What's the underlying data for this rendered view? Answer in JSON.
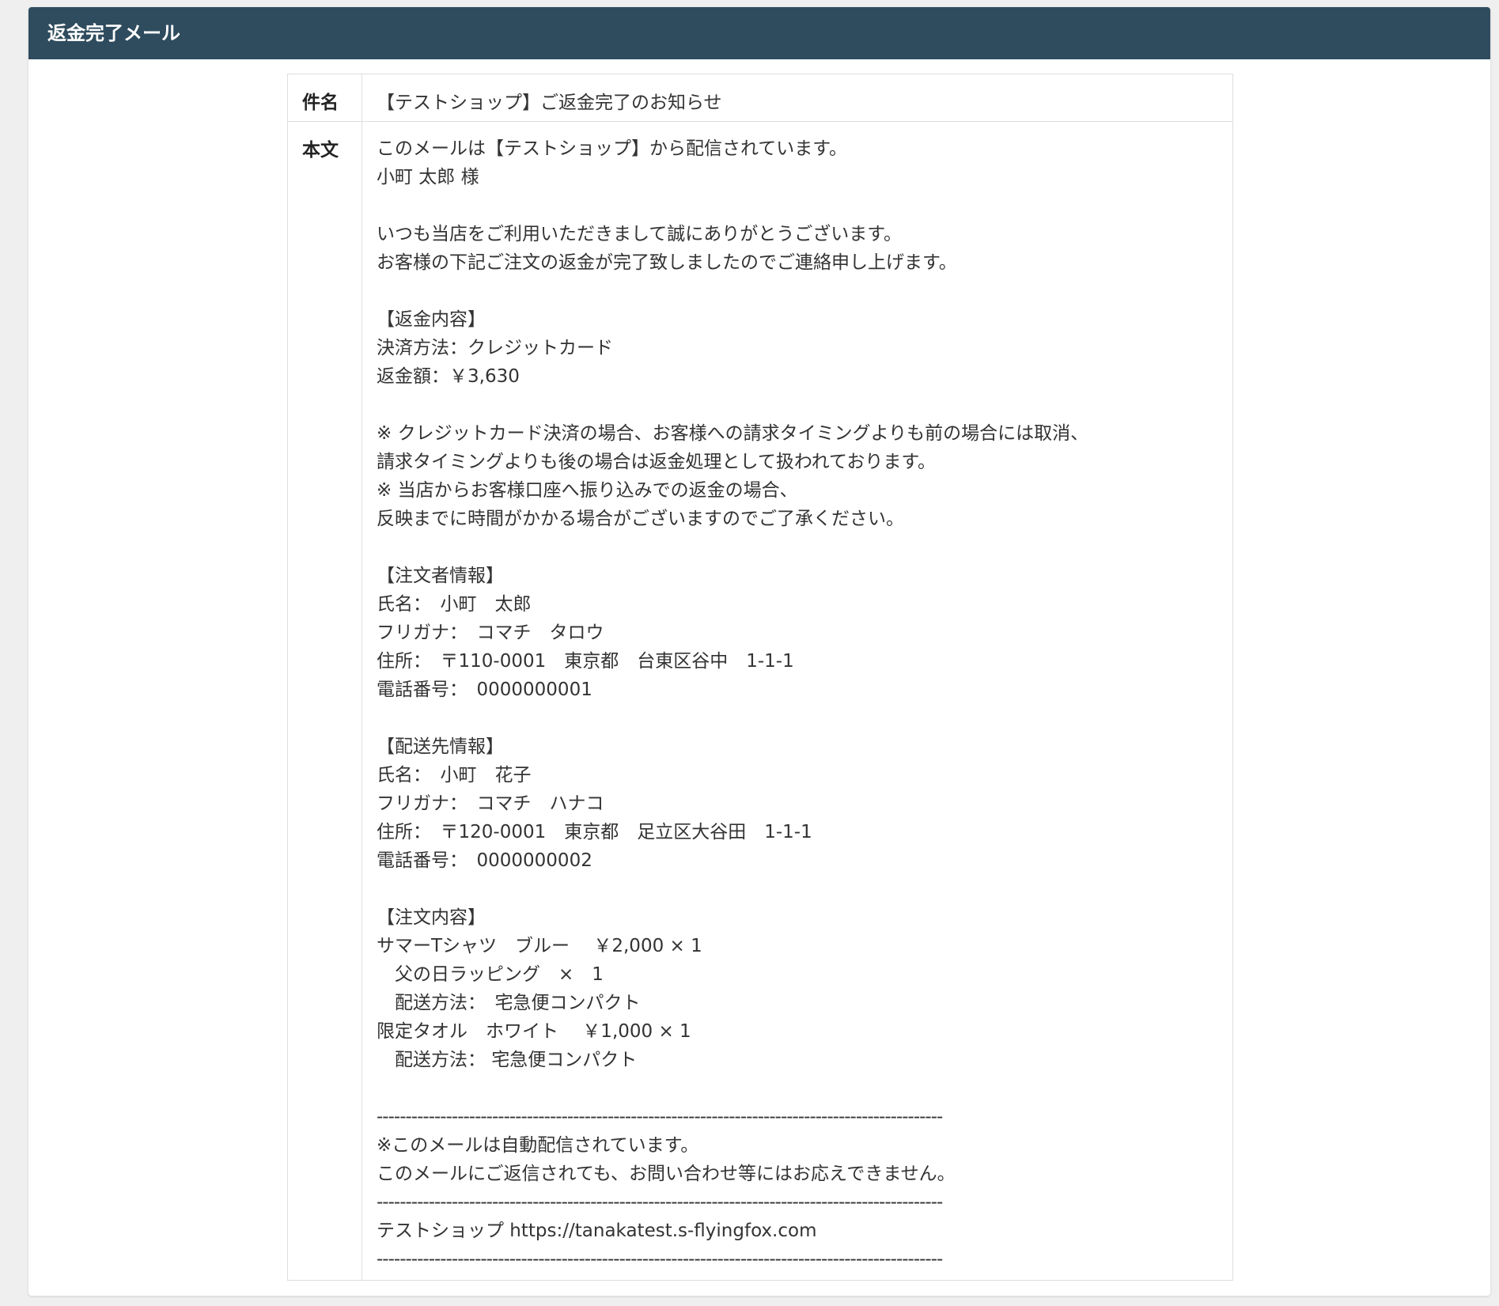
{
  "panel": {
    "title": "返金完了メール"
  },
  "mail": {
    "subject_label": "件名",
    "subject": "【テストショップ】ご返金完了のお知らせ",
    "body_label": "本文",
    "body_lines": [
      "このメールは【テストショップ】から配信されています。",
      "小町 太郎 様",
      "",
      "いつも当店をご利用いただきまして誠にありがとうございます。",
      "お客様の下記ご注文の返金が完了致しましたのでご連絡申し上げます。",
      "",
      "【返金内容】",
      "決済方法：クレジットカード",
      "返金額：￥3,630",
      "",
      "※ クレジットカード決済の場合、お客様への請求タイミングよりも前の場合には取消、",
      "請求タイミングよりも後の場合は返金処理として扱われております。",
      "※ 当店からお客様口座へ振り込みでの返金の場合、",
      "反映までに時間がかかる場合がございますのでご了承ください。",
      "",
      "【注文者情報】",
      "氏名：　小町　太郎",
      "フリガナ：　コマチ　タロウ",
      "住所：　〒110-0001　東京都　台東区谷中　1-1-1",
      "電話番号：　0000000001",
      "",
      "【配送先情報】",
      "氏名：　小町　花子",
      "フリガナ：　コマチ　ハナコ",
      "住所：　〒120-0001　東京都　足立区大谷田　1-1-1",
      "電話番号：　0000000002",
      "",
      "【注文内容】",
      "サマーTシャツ　ブルー　 ￥2,000 × 1",
      "　父の日ラッピング　×　1",
      "　配送方法：　宅急便コンパクト",
      "限定タオル　ホワイト　 ￥1,000 × 1",
      "　配送方法： 宅急便コンパクト",
      ""
    ],
    "separator": "--------------------------------------------------------------------------------------------------",
    "footer_lines": [
      "※このメールは自動配信されています。",
      "このメールにご返信されても、お問い合わせ等にはお応えできません。"
    ],
    "signature": "テストショップ https://tanakatest.s-flyingfox.com"
  },
  "colors": {
    "header_bg": "#2f4c5e",
    "header_text": "#ffffff",
    "page_bg": "#efefef",
    "border": "#dedede",
    "text": "#333333"
  }
}
